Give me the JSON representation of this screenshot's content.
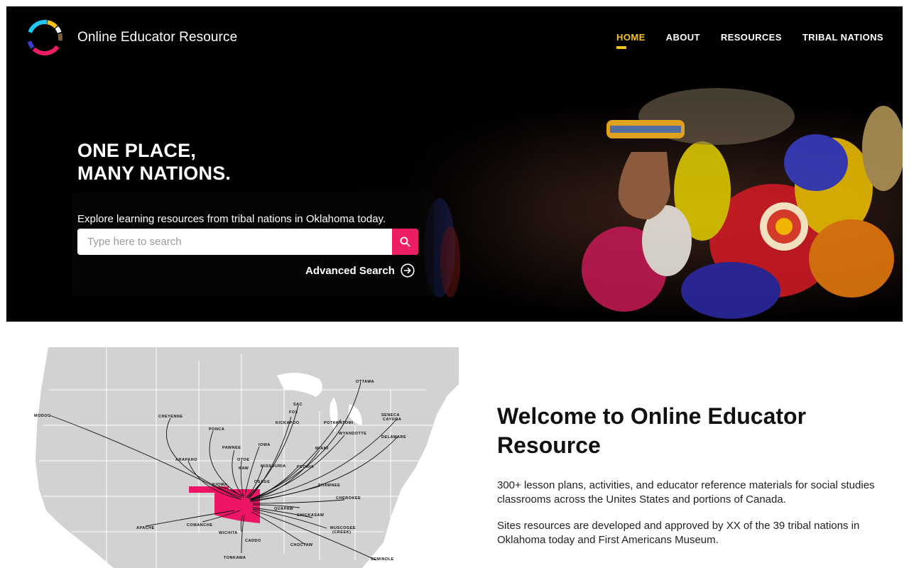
{
  "header": {
    "site_title": "Online Educator Resource",
    "logo_icon": "ring-logo-icon",
    "nav": [
      {
        "label": "HOME",
        "active": true
      },
      {
        "label": "ABOUT",
        "active": false
      },
      {
        "label": "RESOURCES",
        "active": false
      },
      {
        "label": "TRIBAL NATIONS",
        "active": false
      }
    ],
    "active_color": "#f7c21a"
  },
  "hero": {
    "tagline_line1": "ONE PLACE,",
    "tagline_line2": "MANY NATIONS.",
    "explore_text": "Explore learning resources from tribal nations in Oklahoma today.",
    "search": {
      "placeholder": "Type here to search",
      "value": "",
      "button_icon": "search-icon",
      "button_color": "#ec1d65"
    },
    "advanced_search_label": "Advanced Search",
    "advanced_search_icon": "arrow-circle-right-icon"
  },
  "map": {
    "highlight_color": "#ef1566",
    "tribe_labels": [
      "MODOC",
      "CHEYENNE",
      "PONCA",
      "PAWNEE",
      "IOWA",
      "OTOE",
      "KAW",
      "ARAPAHO",
      "MISSOURIA",
      "OSAGE",
      "SAC",
      "FOX",
      "KICKAPOO",
      "POTAWATOMI",
      "OTTAWA",
      "SENECA CAYUGA",
      "WYANDOTTE",
      "DELAWARE",
      "MIAMI",
      "PEORIA",
      "SHAWNEE",
      "KIOWA",
      "CHEROKEE",
      "QUAPAW",
      "CHICKASAW",
      "APACHE",
      "COMANCHE",
      "WICHITA",
      "CADDO",
      "MUSCOGEE (CREEK)",
      "CHOCTAW",
      "TONKAWA",
      "SEMINOLE"
    ]
  },
  "welcome": {
    "title": "Welcome to Online Educator Resource",
    "paragraph1": "300+ lesson plans, activities, and educator reference materials for social studies classrooms across the Unites States and portions of Canada.",
    "paragraph2": "Sites resources are developed and approved by XX of the 39 tribal nations in Oklahoma today and First Americans Museum."
  }
}
